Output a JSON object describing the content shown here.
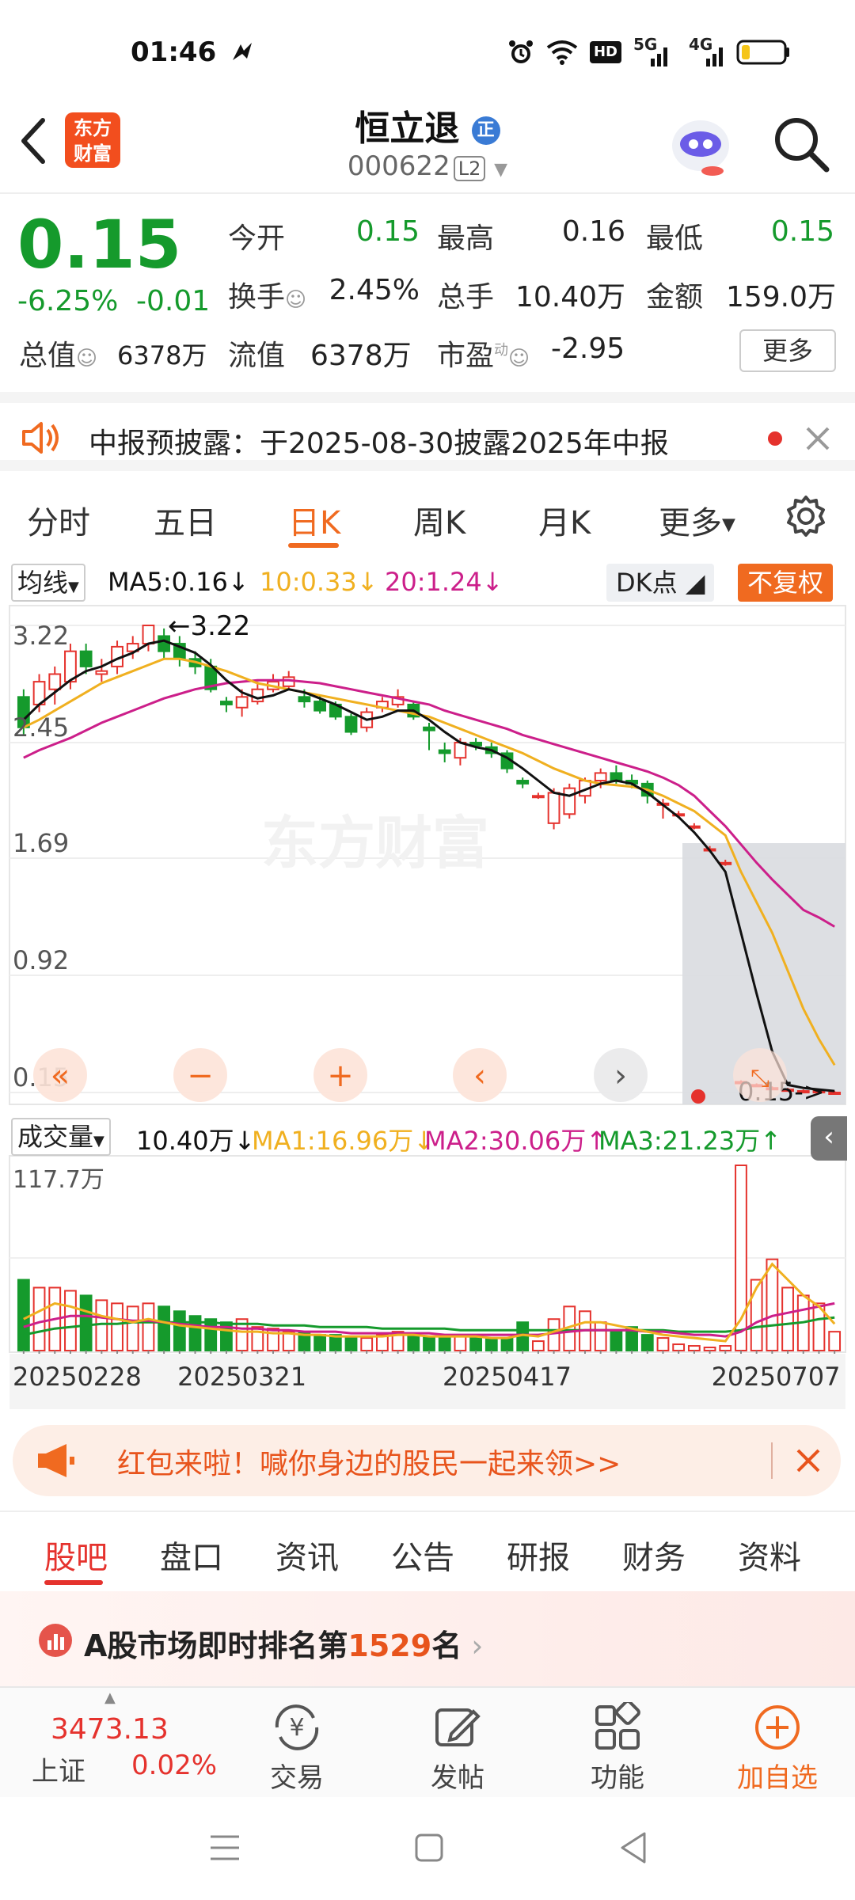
{
  "status": {
    "time": "01:46",
    "signal_5g": "5G",
    "signal_4g": "4G",
    "hd": "HD"
  },
  "header": {
    "brand": "东方\n财富",
    "name": "恒立退",
    "badge": "正",
    "code": "000622",
    "level": "L2"
  },
  "quote": {
    "price": "0.15",
    "change_pct": "-6.25%",
    "change_abs": "-0.01",
    "open_label": "今开",
    "open": "0.15",
    "high_label": "最高",
    "high": "0.16",
    "low_label": "最低",
    "low": "0.15",
    "turnover_label": "换手",
    "turnover": "2.45%",
    "volume_label": "总手",
    "volume": "10.40万",
    "amount_label": "金额",
    "amount": "159.0万",
    "mktcap_label": "总值",
    "mktcap": "6378万",
    "float_label": "流值",
    "float": "6378万",
    "pe_label": "市盈",
    "pe_sup": "动",
    "pe": "-2.95",
    "more": "更多"
  },
  "notice": {
    "text": "中报预披露：于2025-08-30披露2025年中报"
  },
  "ktabs": [
    "分时",
    "五日",
    "日K",
    "周K",
    "月K",
    "更多"
  ],
  "active_ktab": "日K",
  "indicators": {
    "ma_select": "均线",
    "ma5": "MA5:0.16",
    "ma10": "10:0.33",
    "ma20": "20:1.24",
    "dk": "DK点",
    "fq": "不复权",
    "vol_select": "成交量",
    "vol": "10.40万",
    "vma1": "MA1:16.96万",
    "vma2": "MA2:30.06万",
    "vma3": "MA3:21.23万",
    "vol_max": "117.7万"
  },
  "price_axis": [
    "3.22",
    "2.45",
    "1.69",
    "0.92",
    "0.15"
  ],
  "annotations": {
    "high": "3.22",
    "last": "0.15->"
  },
  "watermark": "东方财富",
  "date_axis": [
    "20250228",
    "20250321",
    "20250417",
    "20250707"
  ],
  "colors": {
    "up": "#e5322d",
    "down": "#159a2c",
    "ma5": "#111111",
    "ma10": "#f0b020",
    "ma20": "#cc1f8a",
    "accent": "#ff6a00"
  },
  "chart_data": {
    "type": "candlestick",
    "ylim": [
      0.15,
      3.22
    ],
    "candles": [
      {
        "o": 2.75,
        "c": 2.55,
        "h": 2.8,
        "l": 2.5
      },
      {
        "o": 2.7,
        "c": 2.85,
        "h": 2.9,
        "l": 2.65
      },
      {
        "o": 2.8,
        "c": 2.9,
        "h": 2.95,
        "l": 2.7
      },
      {
        "o": 2.85,
        "c": 3.05,
        "h": 3.1,
        "l": 2.8
      },
      {
        "o": 3.05,
        "c": 2.95,
        "h": 3.1,
        "l": 2.9
      },
      {
        "o": 2.9,
        "c": 2.92,
        "h": 3.0,
        "l": 2.85
      },
      {
        "o": 2.95,
        "c": 3.08,
        "h": 3.12,
        "l": 2.9
      },
      {
        "o": 3.05,
        "c": 3.1,
        "h": 3.15,
        "l": 3.0
      },
      {
        "o": 3.1,
        "c": 3.22,
        "h": 3.22,
        "l": 3.05
      },
      {
        "o": 3.15,
        "c": 3.05,
        "h": 3.2,
        "l": 3.0
      },
      {
        "o": 3.1,
        "c": 3.0,
        "h": 3.15,
        "l": 2.95
      },
      {
        "o": 3.0,
        "c": 2.95,
        "h": 3.05,
        "l": 2.9
      },
      {
        "o": 2.95,
        "c": 2.8,
        "h": 3.0,
        "l": 2.78
      },
      {
        "o": 2.72,
        "c": 2.7,
        "h": 2.75,
        "l": 2.65
      },
      {
        "o": 2.68,
        "c": 2.75,
        "h": 2.8,
        "l": 2.62
      },
      {
        "o": 2.72,
        "c": 2.8,
        "h": 2.85,
        "l": 2.7
      },
      {
        "o": 2.8,
        "c": 2.85,
        "h": 2.9,
        "l": 2.78
      },
      {
        "o": 2.82,
        "c": 2.88,
        "h": 2.92,
        "l": 2.8
      },
      {
        "o": 2.75,
        "c": 2.72,
        "h": 2.8,
        "l": 2.68
      },
      {
        "o": 2.72,
        "c": 2.66,
        "h": 2.76,
        "l": 2.64
      },
      {
        "o": 2.7,
        "c": 2.62,
        "h": 2.72,
        "l": 2.6
      },
      {
        "o": 2.62,
        "c": 2.52,
        "h": 2.64,
        "l": 2.5
      },
      {
        "o": 2.55,
        "c": 2.65,
        "h": 2.68,
        "l": 2.52
      },
      {
        "o": 2.68,
        "c": 2.72,
        "h": 2.75,
        "l": 2.65
      },
      {
        "o": 2.7,
        "c": 2.75,
        "h": 2.8,
        "l": 2.68
      },
      {
        "o": 2.7,
        "c": 2.62,
        "h": 2.72,
        "l": 2.6
      },
      {
        "o": 2.55,
        "c": 2.53,
        "h": 2.58,
        "l": 2.4
      },
      {
        "o": 2.4,
        "c": 2.38,
        "h": 2.45,
        "l": 2.32
      },
      {
        "o": 2.35,
        "c": 2.45,
        "h": 2.48,
        "l": 2.3
      },
      {
        "o": 2.45,
        "c": 2.43,
        "h": 2.48,
        "l": 2.4
      },
      {
        "o": 2.42,
        "c": 2.38,
        "h": 2.45,
        "l": 2.35
      },
      {
        "o": 2.38,
        "c": 2.28,
        "h": 2.4,
        "l": 2.25
      },
      {
        "o": 2.2,
        "c": 2.18,
        "h": 2.22,
        "l": 2.15
      },
      {
        "o": 2.1,
        "c": 2.1,
        "h": 2.12,
        "l": 2.08
      },
      {
        "o": 1.92,
        "c": 2.12,
        "h": 2.15,
        "l": 1.88
      },
      {
        "o": 1.98,
        "c": 2.15,
        "h": 2.18,
        "l": 1.95
      },
      {
        "o": 2.1,
        "c": 2.2,
        "h": 2.22,
        "l": 2.05
      },
      {
        "o": 2.2,
        "c": 2.25,
        "h": 2.28,
        "l": 2.15
      },
      {
        "o": 2.25,
        "c": 2.2,
        "h": 2.3,
        "l": 2.18
      },
      {
        "o": 2.2,
        "c": 2.18,
        "h": 2.24,
        "l": 2.15
      },
      {
        "o": 2.18,
        "c": 2.1,
        "h": 2.2,
        "l": 2.05
      },
      {
        "o": 2.05,
        "c": 2.05,
        "h": 2.08,
        "l": 1.95
      },
      {
        "o": 1.98,
        "c": 1.98,
        "h": 2.0,
        "l": 1.96
      },
      {
        "o": 1.9,
        "c": 1.9,
        "h": 1.92,
        "l": 1.88
      },
      {
        "o": 1.75,
        "c": 1.75,
        "h": 1.77,
        "l": 1.73
      },
      {
        "o": 1.66,
        "c": 1.66,
        "h": 1.68,
        "l": 1.64
      },
      {
        "o": 0.22,
        "c": 0.22,
        "h": 0.23,
        "l": 0.21
      },
      {
        "o": 0.2,
        "c": 0.2,
        "h": 0.21,
        "l": 0.19
      },
      {
        "o": 0.18,
        "c": 0.18,
        "h": 0.19,
        "l": 0.17
      },
      {
        "o": 0.17,
        "c": 0.17,
        "h": 0.18,
        "l": 0.16
      },
      {
        "o": 0.16,
        "c": 0.16,
        "h": 0.17,
        "l": 0.15
      },
      {
        "o": 0.16,
        "c": 0.16,
        "h": 0.16,
        "l": 0.15
      },
      {
        "o": 0.15,
        "c": 0.15,
        "h": 0.16,
        "l": 0.15
      }
    ],
    "volumes": [
      45,
      40,
      40,
      38,
      35,
      32,
      30,
      28,
      30,
      28,
      25,
      22,
      20,
      18,
      20,
      15,
      14,
      12,
      12,
      10,
      10,
      9,
      8,
      10,
      12,
      10,
      9,
      8,
      10,
      9,
      8,
      8,
      18,
      6,
      20,
      28,
      25,
      18,
      12,
      15,
      10,
      8,
      4,
      3,
      2,
      3,
      117.7,
      45,
      58,
      40,
      35,
      30,
      12
    ],
    "ma5": [
      2.6,
      2.7,
      2.78,
      2.86,
      2.92,
      2.95,
      3.0,
      3.04,
      3.1,
      3.12,
      3.08,
      3.04,
      2.96,
      2.86,
      2.78,
      2.74,
      2.76,
      2.8,
      2.78,
      2.74,
      2.7,
      2.65,
      2.6,
      2.62,
      2.66,
      2.66,
      2.6,
      2.52,
      2.45,
      2.42,
      2.4,
      2.35,
      2.28,
      2.2,
      2.12,
      2.1,
      2.14,
      2.18,
      2.2,
      2.18,
      2.12,
      2.04,
      1.96,
      1.86,
      1.74,
      1.6,
      1.2,
      0.8,
      0.42,
      0.2,
      0.18,
      0.17,
      0.16
    ],
    "ma10": [
      2.55,
      2.6,
      2.66,
      2.72,
      2.78,
      2.84,
      2.88,
      2.92,
      2.96,
      3.0,
      3.0,
      2.98,
      2.95,
      2.92,
      2.88,
      2.84,
      2.82,
      2.8,
      2.78,
      2.76,
      2.74,
      2.72,
      2.7,
      2.68,
      2.66,
      2.64,
      2.62,
      2.58,
      2.54,
      2.5,
      2.46,
      2.42,
      2.38,
      2.33,
      2.28,
      2.24,
      2.2,
      2.18,
      2.17,
      2.16,
      2.14,
      2.1,
      2.05,
      2.0,
      1.92,
      1.84,
      1.6,
      1.4,
      1.2,
      0.95,
      0.7,
      0.5,
      0.33
    ],
    "ma20": [
      2.35,
      2.4,
      2.44,
      2.48,
      2.53,
      2.58,
      2.62,
      2.66,
      2.7,
      2.74,
      2.77,
      2.8,
      2.82,
      2.84,
      2.85,
      2.86,
      2.86,
      2.86,
      2.85,
      2.84,
      2.82,
      2.8,
      2.78,
      2.76,
      2.74,
      2.72,
      2.7,
      2.66,
      2.63,
      2.6,
      2.57,
      2.54,
      2.5,
      2.47,
      2.44,
      2.41,
      2.38,
      2.35,
      2.32,
      2.29,
      2.26,
      2.22,
      2.17,
      2.1,
      2.0,
      1.9,
      1.78,
      1.66,
      1.55,
      1.45,
      1.35,
      1.3,
      1.24
    ],
    "vma1": [
      20,
      25,
      30,
      28,
      25,
      22,
      20,
      18,
      20,
      18,
      16,
      15,
      14,
      13,
      12,
      12,
      11,
      11,
      10,
      10,
      9,
      9,
      9,
      9,
      10,
      10,
      9,
      9,
      9,
      9,
      8,
      8,
      10,
      9,
      12,
      15,
      18,
      18,
      16,
      14,
      12,
      10,
      9,
      8,
      7,
      6,
      20,
      40,
      55,
      45,
      35,
      28,
      17
    ],
    "vma2": [
      15,
      18,
      20,
      22,
      22,
      21,
      20,
      19,
      19,
      18,
      17,
      16,
      15,
      15,
      14,
      14,
      13,
      13,
      12,
      12,
      12,
      11,
      11,
      11,
      11,
      11,
      11,
      10,
      10,
      10,
      10,
      10,
      10,
      10,
      11,
      12,
      13,
      13,
      13,
      13,
      12,
      12,
      11,
      10,
      10,
      9,
      12,
      18,
      22,
      24,
      26,
      28,
      30
    ],
    "vma3": [
      10,
      12,
      14,
      15,
      16,
      17,
      17,
      18,
      18,
      18,
      18,
      18,
      18,
      17,
      17,
      17,
      16,
      16,
      16,
      15,
      15,
      15,
      15,
      14,
      14,
      14,
      14,
      14,
      13,
      13,
      13,
      13,
      13,
      13,
      13,
      13,
      13,
      13,
      13,
      13,
      13,
      13,
      12,
      12,
      12,
      12,
      13,
      15,
      16,
      17,
      18,
      20,
      21
    ]
  },
  "promo": {
    "text": "红包来啦！喊你身边的股民一起来领>>"
  },
  "btabs": [
    "股吧",
    "盘口",
    "资讯",
    "公告",
    "研报",
    "财务",
    "资料"
  ],
  "active_btab": "股吧",
  "rank": {
    "prefix": "A股市场即时排名第",
    "num": "1529",
    "suffix": "名"
  },
  "index": {
    "value": "3473.13",
    "name": "上证",
    "change": "0.02%"
  },
  "nav": [
    "交易",
    "发帖",
    "功能",
    "加自选"
  ]
}
